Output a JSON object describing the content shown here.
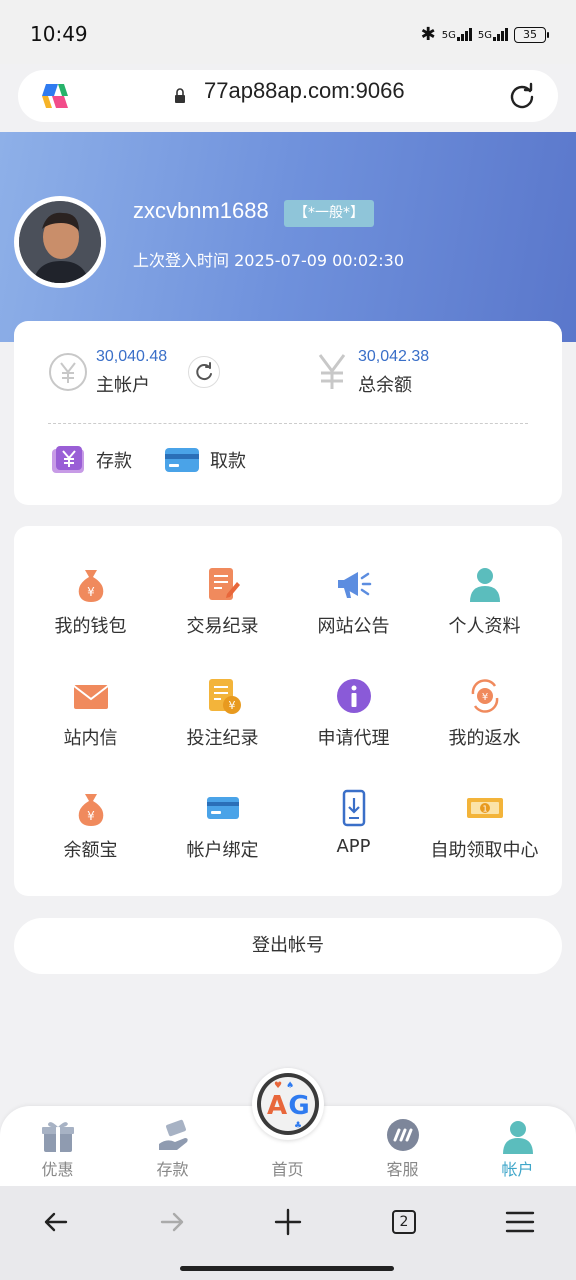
{
  "status_bar": {
    "time": "10:49",
    "network_1": "5G",
    "network_2": "5G",
    "battery": "35"
  },
  "browser": {
    "url": "77ap88ap.com:9066",
    "tab_count": "2"
  },
  "profile": {
    "username": "zxcvbnm1688",
    "level_badge": "【*一般*】",
    "last_login": "上次登入时间 2025-07-09 00:02:30"
  },
  "balances": {
    "main_value": "30,040.48",
    "main_label": "主帐户",
    "total_value": "30,042.38",
    "total_label": "总余额"
  },
  "actions": {
    "deposit": "存款",
    "withdraw": "取款"
  },
  "menu": [
    {
      "label": "我的钱包",
      "icon": "money-bag-icon"
    },
    {
      "label": "交易纪录",
      "icon": "document-edit-icon"
    },
    {
      "label": "网站公告",
      "icon": "megaphone-icon"
    },
    {
      "label": "个人资料",
      "icon": "user-icon"
    },
    {
      "label": "站内信",
      "icon": "envelope-icon"
    },
    {
      "label": "投注纪录",
      "icon": "bet-record-icon"
    },
    {
      "label": "申请代理",
      "icon": "info-icon"
    },
    {
      "label": "我的返水",
      "icon": "rebate-icon"
    },
    {
      "label": "余额宝",
      "icon": "money-bag-icon"
    },
    {
      "label": "帐户绑定",
      "icon": "card-icon"
    },
    {
      "label": "APP",
      "icon": "phone-download-icon"
    },
    {
      "label": "自助领取中心",
      "icon": "banknote-icon"
    }
  ],
  "logout_label": "登出帐号",
  "bottom_nav": [
    {
      "label": "优惠",
      "icon": "gift-icon"
    },
    {
      "label": "存款",
      "icon": "hand-money-icon"
    },
    {
      "label": "首页",
      "icon": "ag-logo-icon"
    },
    {
      "label": "客服",
      "icon": "chat-icon"
    },
    {
      "label": "帐户",
      "icon": "user-icon",
      "active": true
    }
  ],
  "colors": {
    "header_gradient_start": "#8eb0e8",
    "header_gradient_end": "#5a77cb",
    "balance_value": "#3a6fc8",
    "nav_active": "#3fa6c9",
    "icon_orange": "#f08a5d"
  }
}
